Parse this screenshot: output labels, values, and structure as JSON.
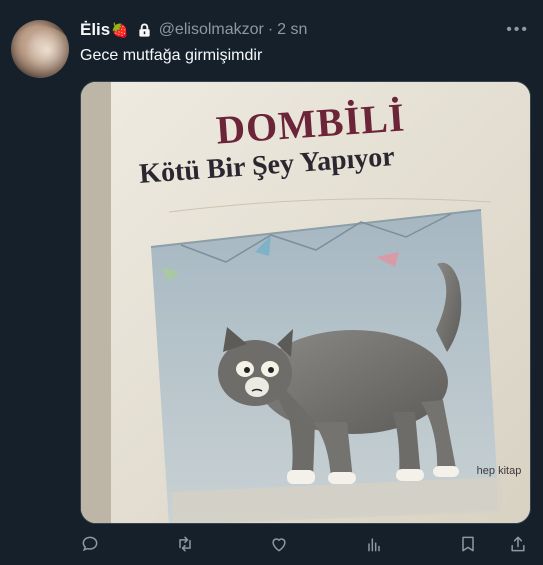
{
  "user": {
    "display_name": "Ėlis",
    "emoji": "🍓",
    "handle": "@elisolmakzor",
    "separator": "·",
    "time": "2 sn",
    "more": "•••"
  },
  "tweet": {
    "text": "Gece mutfağa girmişimdir"
  },
  "media": {
    "book_title": "DOMBİLİ",
    "book_subtitle": "Kötü Bir Şey Yapıyor",
    "publisher": "hep kitap"
  },
  "icons": {
    "reply": "reply-icon",
    "retweet": "retweet-icon",
    "like": "like-icon",
    "views": "views-icon",
    "bookmark": "bookmark-icon",
    "share": "share-icon"
  },
  "colors": {
    "background": "#15202b",
    "secondary_text": "#8b98a5",
    "title_color": "#6b2438"
  }
}
